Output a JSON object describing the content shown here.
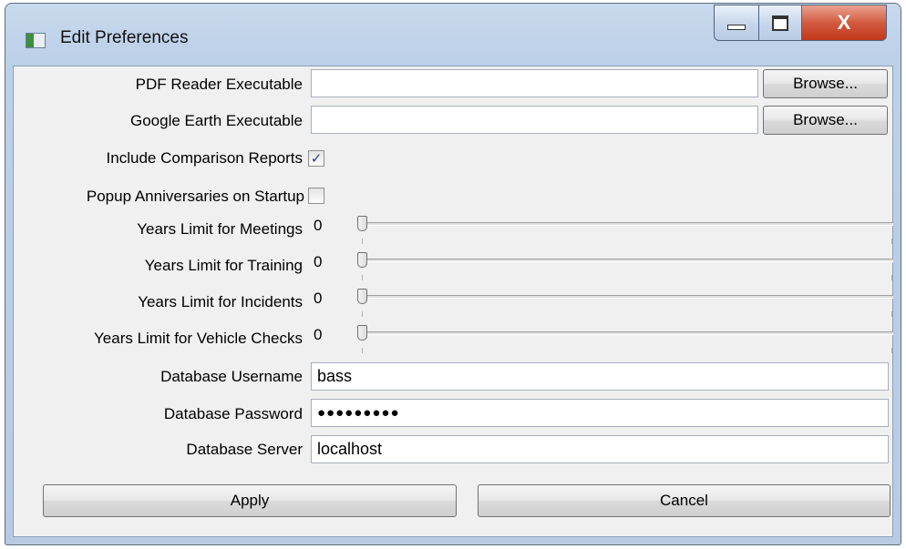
{
  "window": {
    "title": "Edit Preferences",
    "close_glyph": "X"
  },
  "icons": {
    "app": "app-icon",
    "minimize": "minimize-icon",
    "maximize": "maximize-icon",
    "close": "close-icon",
    "checkmark": "checkmark-icon"
  },
  "form": {
    "pdf_reader": {
      "label": "PDF Reader Executable",
      "value": "",
      "browse": "Browse..."
    },
    "google_earth": {
      "label": "Google Earth Executable",
      "value": "",
      "browse": "Browse..."
    },
    "comparison_reports": {
      "label": "Include Comparison Reports",
      "checked": true,
      "glyph": "✓"
    },
    "popup_anniversaries": {
      "label": "Popup Anniversaries on Startup",
      "checked": false
    },
    "meetings": {
      "label": "Years Limit for Meetings",
      "value": "0"
    },
    "training": {
      "label": "Years Limit for Training",
      "value": "0"
    },
    "incidents": {
      "label": "Years Limit for Incidents",
      "value": "0"
    },
    "vehicle_checks": {
      "label": "Years Limit for Vehicle Checks",
      "value": "0"
    },
    "db_username": {
      "label": "Database Username",
      "value": "bass"
    },
    "db_password": {
      "label": "Database Password",
      "value": "●●●●●●●●●"
    },
    "db_server": {
      "label": "Database Server",
      "value": "localhost"
    }
  },
  "buttons": {
    "apply": "Apply",
    "cancel": "Cancel"
  }
}
